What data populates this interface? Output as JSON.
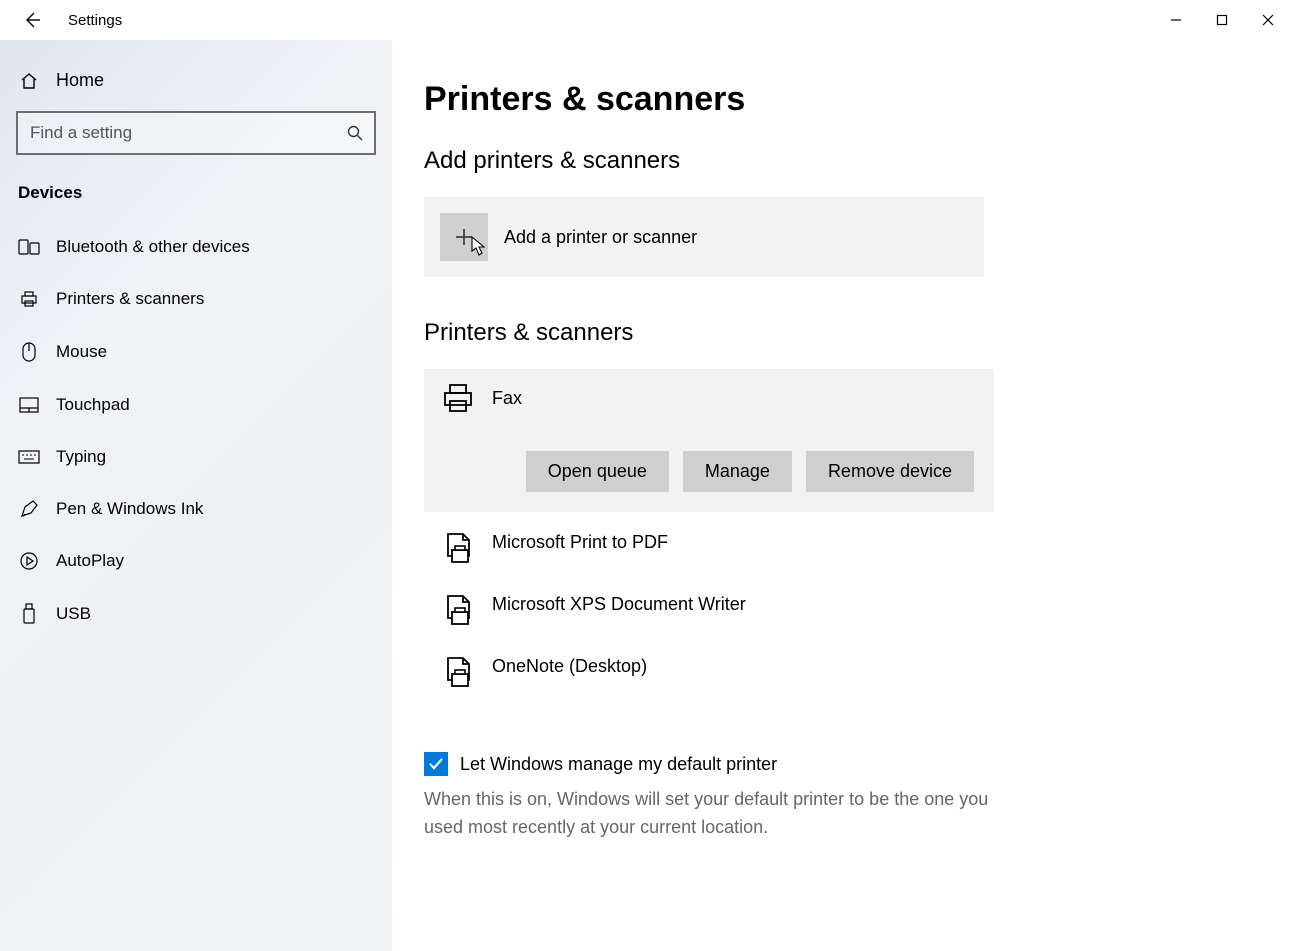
{
  "window": {
    "title": "Settings"
  },
  "sidebar": {
    "home": "Home",
    "search_placeholder": "Find a setting",
    "group": "Devices",
    "items": [
      {
        "label": "Bluetooth & other devices",
        "icon": "bluetooth-devices-icon"
      },
      {
        "label": "Printers & scanners",
        "icon": "printer-icon"
      },
      {
        "label": "Mouse",
        "icon": "mouse-icon"
      },
      {
        "label": "Touchpad",
        "icon": "touchpad-icon"
      },
      {
        "label": "Typing",
        "icon": "keyboard-icon"
      },
      {
        "label": "Pen & Windows Ink",
        "icon": "pen-icon"
      },
      {
        "label": "AutoPlay",
        "icon": "autoplay-icon"
      },
      {
        "label": "USB",
        "icon": "usb-icon"
      }
    ]
  },
  "main": {
    "page_title": "Printers & scanners",
    "add_section_title": "Add printers & scanners",
    "add_button_label": "Add a printer or scanner",
    "list_section_title": "Printers & scanners",
    "printers": [
      {
        "name": "Fax"
      },
      {
        "name": "Microsoft Print to PDF"
      },
      {
        "name": "Microsoft XPS Document Writer"
      },
      {
        "name": "OneNote (Desktop)"
      }
    ],
    "actions": {
      "open_queue": "Open queue",
      "manage": "Manage",
      "remove": "Remove device"
    },
    "checkbox_label": "Let Windows manage my default printer",
    "checkbox_checked": true,
    "help_text": "When this is on, Windows will set your default printer to be the one you used most recently at your current location."
  },
  "colors": {
    "accent": "#0078d7",
    "highlight": "#ff0000"
  }
}
